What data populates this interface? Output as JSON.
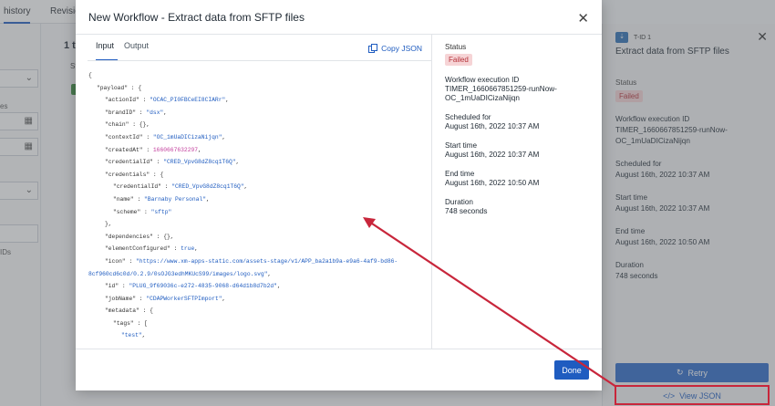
{
  "background": {
    "tabs": [
      "history",
      "Revision"
    ],
    "heading": "1 t",
    "sub": "St",
    "left_labels": [
      "es",
      "IDs"
    ]
  },
  "side_panel": {
    "id_badge": "T-ID 1",
    "title": "Extract data from SFTP files",
    "status_label": "Status",
    "status_value": "Failed",
    "execution_label": "Workflow execution ID",
    "execution_value": "TIMER_1660667851259-runNow-OC_1mUaDICizaNijqn",
    "scheduled_label": "Scheduled for",
    "scheduled_value": "August 16th, 2022 10:37 AM",
    "start_label": "Start time",
    "start_value": "August 16th, 2022 10:37 AM",
    "end_label": "End time",
    "end_value": "August 16th, 2022 10:50 AM",
    "duration_label": "Duration",
    "duration_value": "748 seconds",
    "retry_label": "Retry",
    "view_json_label": "View JSON"
  },
  "modal": {
    "title": "New Workflow - Extract data from SFTP files",
    "tabs": {
      "input": "Input",
      "output": "Output"
    },
    "copy_json_label": "Copy JSON",
    "status_label": "Status",
    "status_value": "Failed",
    "execution_label": "Workflow execution ID",
    "execution_value_1": "TIMER_1660667851259-runNow-",
    "execution_value_2": "OC_1mUaDICizaNijqn",
    "scheduled_label": "Scheduled for",
    "scheduled_value": "August 16th, 2022 10:37 AM",
    "start_label": "Start time",
    "start_value": "August 16th, 2022 10:37 AM",
    "end_label": "End time",
    "end_value": "August 16th, 2022 10:50 AM",
    "duration_label": "Duration",
    "duration_value": "748 seconds",
    "done_label": "Done"
  },
  "json_lines": [
    {
      "indent": 0,
      "parts": [
        {
          "t": "{",
          "c": "k"
        }
      ]
    },
    {
      "indent": 1,
      "parts": [
        {
          "t": "\"payload\" : {",
          "c": "k"
        }
      ]
    },
    {
      "indent": 2,
      "parts": [
        {
          "t": "\"actionId\" : ",
          "c": "k"
        },
        {
          "t": "\"OCAC_PI0FBCeEI8CIARr\"",
          "c": "s"
        },
        {
          "t": ",",
          "c": "k"
        }
      ]
    },
    {
      "indent": 2,
      "parts": [
        {
          "t": "\"brandID\" : ",
          "c": "k"
        },
        {
          "t": "\"dsx\"",
          "c": "s"
        },
        {
          "t": ",",
          "c": "k"
        }
      ]
    },
    {
      "indent": 2,
      "parts": [
        {
          "t": "\"chain\" : {},",
          "c": "k"
        }
      ]
    },
    {
      "indent": 2,
      "parts": [
        {
          "t": "\"contextId\" : ",
          "c": "k"
        },
        {
          "t": "\"OC_1mUaDICizaNijqn\"",
          "c": "s"
        },
        {
          "t": ",",
          "c": "k"
        }
      ]
    },
    {
      "indent": 2,
      "parts": [
        {
          "t": "\"createdAt\" : ",
          "c": "k"
        },
        {
          "t": "1660667632297",
          "c": "n"
        },
        {
          "t": ",",
          "c": "k"
        }
      ]
    },
    {
      "indent": 2,
      "parts": [
        {
          "t": "\"credentialId\" : ",
          "c": "k"
        },
        {
          "t": "\"CRED_VpvG8dZ8cq1T6Q\"",
          "c": "s"
        },
        {
          "t": ",",
          "c": "k"
        }
      ]
    },
    {
      "indent": 2,
      "parts": [
        {
          "t": "\"credentials\" : {",
          "c": "k"
        }
      ]
    },
    {
      "indent": 3,
      "parts": [
        {
          "t": "\"credentialId\" : ",
          "c": "k"
        },
        {
          "t": "\"CRED_VpvG8dZ8cq1T6Q\"",
          "c": "s"
        },
        {
          "t": ",",
          "c": "k"
        }
      ]
    },
    {
      "indent": 3,
      "parts": [
        {
          "t": "\"name\" : ",
          "c": "k"
        },
        {
          "t": "\"Barnaby Personal\"",
          "c": "s"
        },
        {
          "t": ",",
          "c": "k"
        }
      ]
    },
    {
      "indent": 3,
      "parts": [
        {
          "t": "\"scheme\" : ",
          "c": "k"
        },
        {
          "t": "\"sftp\"",
          "c": "s"
        }
      ]
    },
    {
      "indent": 2,
      "parts": [
        {
          "t": "},",
          "c": "k"
        }
      ]
    },
    {
      "indent": 2,
      "parts": [
        {
          "t": "\"dependencies\" : {},",
          "c": "k"
        }
      ]
    },
    {
      "indent": 2,
      "parts": [
        {
          "t": "\"elementConfigured\" : ",
          "c": "k"
        },
        {
          "t": "true",
          "c": "s"
        },
        {
          "t": ",",
          "c": "k"
        }
      ]
    },
    {
      "indent": 2,
      "parts": [
        {
          "t": "\"icon\" : ",
          "c": "k"
        },
        {
          "t": "\"https://www.xm-apps-static.com/assets-stage/v1/APP_ba2a1b9a-e9a6-4af9-bd86-",
          "c": "s"
        }
      ]
    },
    {
      "indent": 0,
      "parts": [
        {
          "t": "8cf960cd6c0d/0.2.9/0sOJG3edhMKUcS99/images/logo.svg\"",
          "c": "s"
        },
        {
          "t": ",",
          "c": "k"
        }
      ]
    },
    {
      "indent": 2,
      "parts": [
        {
          "t": "\"id\" : ",
          "c": "k"
        },
        {
          "t": "\"PLUG_9f69036c-e272-4835-9068-d64d1b8d7b2d\"",
          "c": "s"
        },
        {
          "t": ",",
          "c": "k"
        }
      ]
    },
    {
      "indent": 2,
      "parts": [
        {
          "t": "\"jobName\" : ",
          "c": "k"
        },
        {
          "t": "\"CDAPWorkerSFTPImport\"",
          "c": "s"
        },
        {
          "t": ",",
          "c": "k"
        }
      ]
    },
    {
      "indent": 2,
      "parts": [
        {
          "t": "\"metadata\" : {",
          "c": "k"
        }
      ]
    },
    {
      "indent": 3,
      "parts": [
        {
          "t": "\"tags\" : [",
          "c": "k"
        }
      ]
    },
    {
      "indent": 4,
      "parts": [
        {
          "t": "\"test\"",
          "c": "s"
        },
        {
          "t": ",",
          "c": "k"
        }
      ]
    }
  ],
  "colors": {
    "accent": "#1f5cc0",
    "failed_bg": "#f6d4d6",
    "failed_text": "#b53138",
    "annotation": "#c8263b"
  }
}
